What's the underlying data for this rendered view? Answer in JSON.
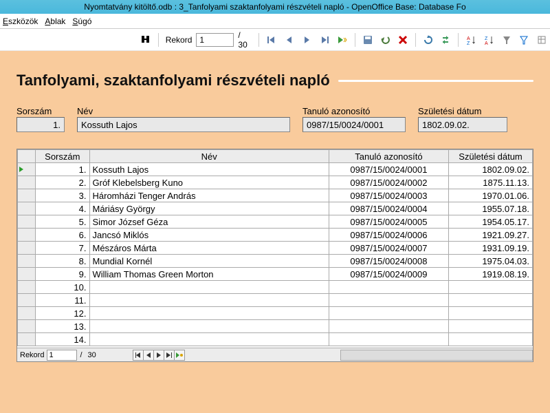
{
  "window": {
    "title": "Nyomtatvány kitöltő.odb : 3_Tanfolyami szaktanfolyami részvételi napló - OpenOffice Base: Database Fo"
  },
  "menu": {
    "tools": "Eszközök",
    "window": "Ablak",
    "help": "Súgó"
  },
  "toolbar": {
    "record_label": "Rekord",
    "record_value": "1",
    "record_total": "/  30"
  },
  "form": {
    "title": "Tanfolyami, szaktanfolyami részvételi napló",
    "fields": {
      "sorszam_label": "Sorszám",
      "sorszam_value": "1.",
      "nev_label": "Név",
      "nev_value": "Kossuth Lajos",
      "tan_label": "Tanuló azonosító",
      "tan_value": "0987/15/0024/0001",
      "szul_label": "Születési dátum",
      "szul_value": "1802.09.02."
    }
  },
  "grid": {
    "headers": {
      "sorszam": "Sorszám",
      "nev": "Név",
      "tan": "Tanuló azonosító",
      "szul": "Születési dátum"
    },
    "rows": [
      {
        "n": "1.",
        "nev": "Kossuth Lajos",
        "tan": "0987/15/0024/0001",
        "szul": "1802.09.02."
      },
      {
        "n": "2.",
        "nev": "Gróf Klebelsberg Kuno",
        "tan": "0987/15/0024/0002",
        "szul": "1875.11.13."
      },
      {
        "n": "3.",
        "nev": "Háromházi Tenger András",
        "tan": "0987/15/0024/0003",
        "szul": "1970.01.06."
      },
      {
        "n": "4.",
        "nev": "Máriásy György",
        "tan": "0987/15/0024/0004",
        "szul": "1955.07.18."
      },
      {
        "n": "5.",
        "nev": "Simor József Géza",
        "tan": "0987/15/0024/0005",
        "szul": "1954.05.17."
      },
      {
        "n": "6.",
        "nev": "Jancsó Miklós",
        "tan": "0987/15/0024/0006",
        "szul": "1921.09.27."
      },
      {
        "n": "7.",
        "nev": "Mészáros Márta",
        "tan": "0987/15/0024/0007",
        "szul": "1931.09.19."
      },
      {
        "n": "8.",
        "nev": "Mundial Kornél",
        "tan": "0987/15/0024/0008",
        "szul": "1975.04.03."
      },
      {
        "n": "9.",
        "nev": "William Thomas Green Morton",
        "tan": "0987/15/0024/0009",
        "szul": "1919.08.19."
      },
      {
        "n": "10.",
        "nev": "",
        "tan": "",
        "szul": ""
      },
      {
        "n": "11.",
        "nev": "",
        "tan": "",
        "szul": ""
      },
      {
        "n": "12.",
        "nev": "",
        "tan": "",
        "szul": ""
      },
      {
        "n": "13.",
        "nev": "",
        "tan": "",
        "szul": ""
      },
      {
        "n": "14.",
        "nev": "",
        "tan": "",
        "szul": ""
      }
    ],
    "nav": {
      "label": "Rekord",
      "value": "1",
      "total": "30",
      "sep": "/"
    }
  }
}
